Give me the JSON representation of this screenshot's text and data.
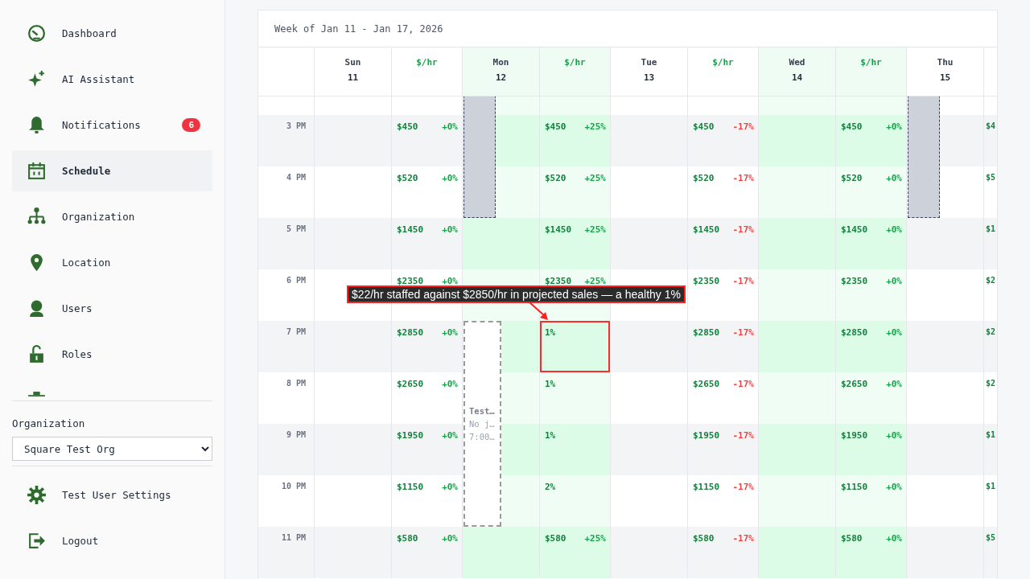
{
  "sidebar": {
    "nav": [
      {
        "label": "Dashboard",
        "selected": false
      },
      {
        "label": "AI Assistant",
        "selected": false
      },
      {
        "label": "Notifications",
        "selected": false,
        "badge": "6"
      },
      {
        "label": "Schedule",
        "selected": true
      },
      {
        "label": "Organization",
        "selected": false
      },
      {
        "label": "Location",
        "selected": false
      },
      {
        "label": "Users",
        "selected": false
      },
      {
        "label": "Roles",
        "selected": false
      }
    ],
    "organization": {
      "label": "Organization",
      "value": "Square Test Org"
    },
    "footer": [
      {
        "label": "Test User Settings"
      },
      {
        "label": "Logout"
      }
    ]
  },
  "schedule": {
    "title": "Week of Jan 11 - Jan 17, 2026",
    "days": [
      {
        "name": "Sun",
        "date": "11",
        "highlighted": false,
        "rate_label": "$/hr"
      },
      {
        "name": "Mon",
        "date": "12",
        "highlighted": true,
        "rate_label": "$/hr"
      },
      {
        "name": "Tue",
        "date": "13",
        "highlighted": false,
        "rate_label": "$/hr"
      },
      {
        "name": "Wed",
        "date": "14",
        "highlighted": true,
        "rate_label": "$/hr"
      },
      {
        "name": "Thu",
        "date": "15",
        "highlighted": false
      }
    ],
    "rows": [
      {
        "cells": [
          {},
          {
            "shift": {
              "kind": "blocked"
            }
          },
          {},
          {},
          {
            "shift": {
              "kind": "blocked"
            }
          }
        ]
      },
      {
        "time": "3 PM",
        "cells": [
          {
            "rate": {
              "amount": "$450",
              "change": "+0%",
              "negative": false
            }
          },
          {
            "shift": {
              "kind": "blocked"
            },
            "rate": {
              "amount": "$450",
              "change": "+25%",
              "negative": false
            }
          },
          {
            "rate": {
              "amount": "$450",
              "change": "-17%",
              "negative": true
            }
          },
          {
            "rate": {
              "amount": "$450",
              "change": "+0%",
              "negative": false
            }
          },
          {
            "shift": {
              "kind": "blocked"
            },
            "rate": {
              "amount": "$4"
            }
          }
        ]
      },
      {
        "time": "4 PM",
        "cells": [
          {
            "rate": {
              "amount": "$520",
              "change": "+0%",
              "negative": false
            }
          },
          {
            "shift": {
              "kind": "blocked"
            },
            "rate": {
              "amount": "$520",
              "change": "+25%",
              "negative": false
            }
          },
          {
            "rate": {
              "amount": "$520",
              "change": "-17%",
              "negative": true
            }
          },
          {
            "rate": {
              "amount": "$520",
              "change": "+0%",
              "negative": false
            }
          },
          {
            "shift": {
              "kind": "blocked"
            },
            "rate": {
              "amount": "$5"
            }
          }
        ]
      },
      {
        "time": "5 PM",
        "cells": [
          {
            "rate": {
              "amount": "$1450",
              "change": "+0%",
              "negative": false
            }
          },
          {
            "rate": {
              "amount": "$1450",
              "change": "+25%",
              "negative": false
            }
          },
          {
            "rate": {
              "amount": "$1450",
              "change": "-17%",
              "negative": true
            }
          },
          {
            "rate": {
              "amount": "$1450",
              "change": "+0%",
              "negative": false
            }
          },
          {
            "rate": {
              "amount": "$1"
            }
          }
        ]
      },
      {
        "time": "6 PM",
        "cells": [
          {
            "rate": {
              "amount": "$2350",
              "change": "+0%",
              "negative": false
            }
          },
          {
            "rate": {
              "amount": "$2350",
              "change": "+25%",
              "negative": false
            }
          },
          {
            "rate": {
              "amount": "$2350",
              "change": "-17%",
              "negative": true
            }
          },
          {
            "rate": {
              "amount": "$2350",
              "change": "+0%",
              "negative": false
            }
          },
          {
            "rate": {
              "amount": "$2"
            }
          }
        ]
      },
      {
        "time": "7 PM",
        "cells": [
          {
            "rate": {
              "amount": "$2850",
              "change": "+0%",
              "negative": false
            }
          },
          {
            "shift": {
              "kind": "open",
              "lines": [
                "Test…",
                "No j…",
                "7:00…"
              ]
            },
            "rate": {
              "ratio": "1%",
              "callout": "$22/hr staffed against $2850/hr in projected sales — a healthy 1%"
            }
          },
          {
            "rate": {
              "amount": "$2850",
              "change": "-17%",
              "negative": true
            }
          },
          {
            "rate": {
              "amount": "$2850",
              "change": "+0%",
              "negative": false
            }
          },
          {
            "rate": {
              "amount": "$2"
            }
          }
        ]
      },
      {
        "time": "8 PM",
        "cells": [
          {
            "rate": {
              "amount": "$2650",
              "change": "+0%",
              "negative": false
            }
          },
          {
            "shift": {
              "kind": "open"
            },
            "rate": {
              "ratio": "1%"
            }
          },
          {
            "rate": {
              "amount": "$2650",
              "change": "-17%",
              "negative": true
            }
          },
          {
            "rate": {
              "amount": "$2650",
              "change": "+0%",
              "negative": false
            }
          },
          {
            "rate": {
              "amount": "$2"
            }
          }
        ]
      },
      {
        "time": "9 PM",
        "cells": [
          {
            "rate": {
              "amount": "$1950",
              "change": "+0%",
              "negative": false
            }
          },
          {
            "shift": {
              "kind": "open"
            },
            "rate": {
              "ratio": "1%"
            }
          },
          {
            "rate": {
              "amount": "$1950",
              "change": "-17%",
              "negative": true
            }
          },
          {
            "rate": {
              "amount": "$1950",
              "change": "+0%",
              "negative": false
            }
          },
          {
            "rate": {
              "amount": "$1"
            }
          }
        ]
      },
      {
        "time": "10 PM",
        "cells": [
          {
            "rate": {
              "amount": "$1150",
              "change": "+0%",
              "negative": false
            }
          },
          {
            "shift": {
              "kind": "open"
            },
            "rate": {
              "ratio": "2%"
            }
          },
          {
            "rate": {
              "amount": "$1150",
              "change": "-17%",
              "negative": true
            }
          },
          {
            "rate": {
              "amount": "$1150",
              "change": "+0%",
              "negative": false
            }
          },
          {
            "rate": {
              "amount": "$1"
            }
          }
        ]
      },
      {
        "time": "11 PM",
        "cells": [
          {
            "rate": {
              "amount": "$580",
              "change": "+0%",
              "negative": false
            }
          },
          {
            "rate": {
              "amount": "$580",
              "change": "+25%",
              "negative": false
            }
          },
          {
            "rate": {
              "amount": "$580",
              "change": "-17%",
              "negative": true
            }
          },
          {
            "rate": {
              "amount": "$580",
              "change": "+0%",
              "negative": false
            }
          },
          {
            "rate": {
              "amount": "$5"
            }
          }
        ]
      }
    ]
  }
}
